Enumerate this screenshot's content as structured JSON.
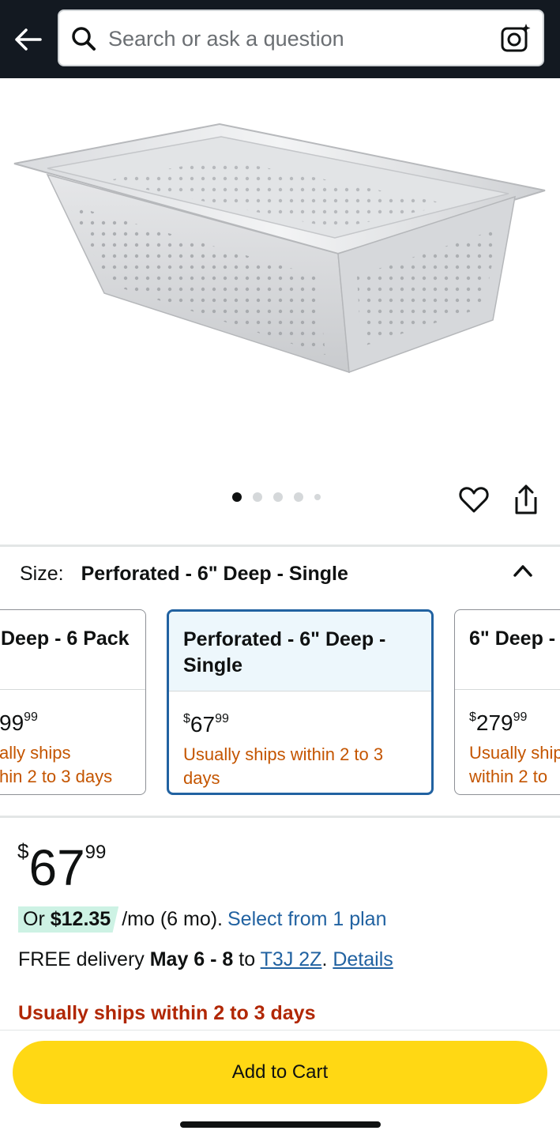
{
  "search": {
    "placeholder": "Search or ask a question"
  },
  "gallery": {
    "image_count": 5,
    "active_index": 0
  },
  "size": {
    "label": "Size:",
    "selected_value": "Perforated - 6\" Deep - Single"
  },
  "variants": [
    {
      "title": "Deep - 6 Pack",
      "price_currency": "",
      "price_whole": "99",
      "price_fraction": "99",
      "shipping_line1": "ally ships",
      "shipping_line2": "hin 2 to 3 days"
    },
    {
      "title": "Perforated - 6\" Deep - Single",
      "price_currency": "$",
      "price_whole": "67",
      "price_fraction": "99",
      "shipping": "Usually ships within 2 to 3 days"
    },
    {
      "title": "6\" Deep -",
      "price_currency": "$",
      "price_whole": "279",
      "price_fraction": "99",
      "shipping_line1": "Usually ship",
      "shipping_line2": "within 2 to"
    }
  ],
  "price": {
    "currency": "$",
    "whole": "67",
    "fraction": "99"
  },
  "plan": {
    "prefix": "Or",
    "amount": "$12.35",
    "suffix": "/mo (6 mo).",
    "link": "Select from 1 plan"
  },
  "delivery": {
    "prefix": "FREE delivery",
    "dates": "May 6 - 8",
    "to": "to",
    "postal_code": "T3J 2Z",
    "separator": ".",
    "details_link": "Details"
  },
  "availability": "Usually ships within 2 to 3 days",
  "cart": {
    "button_label": "Add to Cart"
  },
  "colors": {
    "header_bg": "#131921",
    "button_yellow": "#ffd814",
    "link_blue": "#2162a1",
    "ship_orange": "#c45500",
    "availability_red": "#b12704",
    "plan_green": "#cdf2e4"
  }
}
